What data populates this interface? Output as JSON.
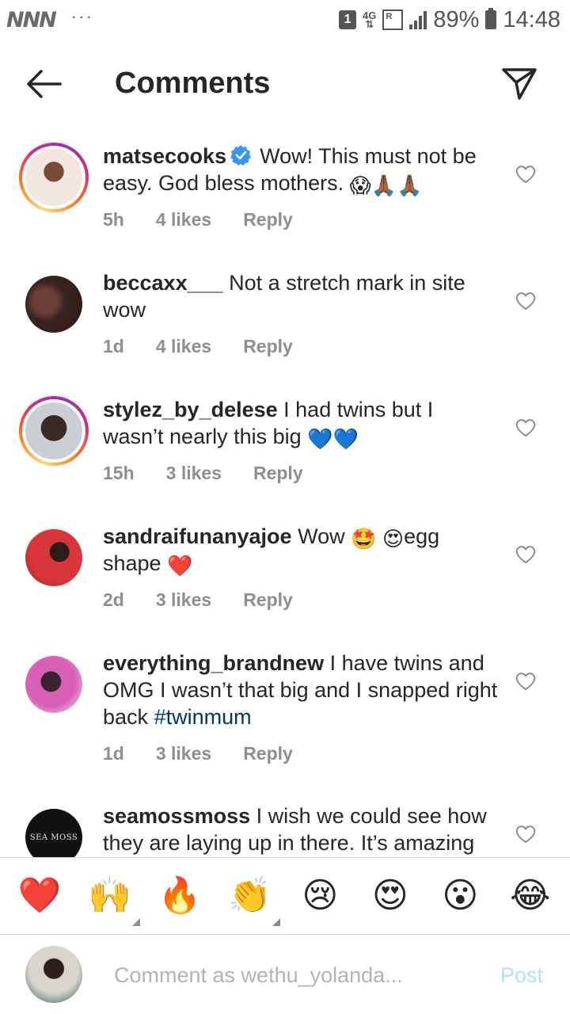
{
  "status_bar": {
    "carrier_logos": "NNN",
    "more": "···",
    "sim_slot": "1",
    "network": "4G",
    "roaming": "R",
    "battery": "89%",
    "time": "14:48"
  },
  "header": {
    "title": "Comments",
    "back_icon": "arrow-left-icon",
    "share_icon": "paper-plane-icon"
  },
  "comments": [
    {
      "username": "matsecooks",
      "verified": true,
      "text": "Wow! This must not be easy. God bless mothers.",
      "emojis": "😱🙏🏾🙏🏾",
      "time": "5h",
      "likes": "4 likes",
      "reply": "Reply"
    },
    {
      "username": "beccaxx___",
      "text": "Not a stretch mark in site wow",
      "time": "1d",
      "likes": "4 likes",
      "reply": "Reply"
    },
    {
      "username": "stylez_by_delese",
      "text": "I had twins but I wasn’t nearly this big",
      "emojis": "💙💙",
      "time": "15h",
      "likes": "3 likes",
      "reply": "Reply"
    },
    {
      "username": "sandraifunanyajoe",
      "text_a": "Wow",
      "emoji_a": "🤩",
      "emoji_b": "😍",
      "text_b": "egg shape",
      "emoji_c": "❤️",
      "time": "2d",
      "likes": "3 likes",
      "reply": "Reply"
    },
    {
      "username": "everything_brandnew",
      "text": "I have twins and OMG I wasn’t that big and I snapped right back",
      "hashtag": "#twinmum",
      "time": "1d",
      "likes": "3 likes",
      "reply": "Reply"
    },
    {
      "username": "seamossmoss",
      "text": "I wish we could see how they are laying up in there. It’s amazing",
      "avatar_text": "SEA MOSS"
    }
  ],
  "reactions": [
    "❤️",
    "🙌",
    "🔥",
    "👏",
    "😢",
    "😍",
    "😮",
    "😂"
  ],
  "composer": {
    "placeholder": "Comment as wethu_yolanda...",
    "post_label": "Post"
  },
  "colors": {
    "text": "#262626",
    "meta": "#8e8e8e",
    "hashtag": "#00376b",
    "verified": "#3897f0",
    "post_disabled": "#b2dffc"
  }
}
